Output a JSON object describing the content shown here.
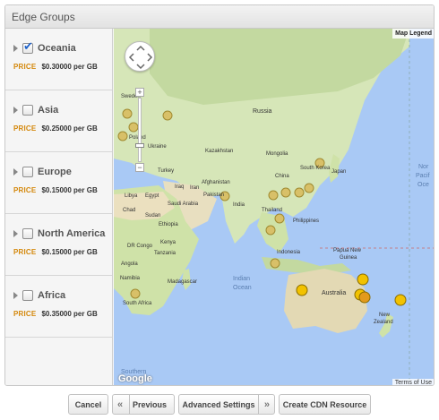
{
  "panel": {
    "title": "Edge Groups"
  },
  "groups": [
    {
      "name": "Oceania",
      "checked": true,
      "price_label": "PRICE",
      "price": "$0.30000 per GB"
    },
    {
      "name": "Asia",
      "checked": false,
      "price_label": "PRICE",
      "price": "$0.25000 per GB"
    },
    {
      "name": "Europe",
      "checked": false,
      "price_label": "PRICE",
      "price": "$0.15000 per GB"
    },
    {
      "name": "North America",
      "checked": false,
      "price_label": "PRICE",
      "price": "$0.15000 per GB"
    },
    {
      "name": "Africa",
      "checked": false,
      "price_label": "PRICE",
      "price": "$0.35000 per GB"
    }
  ],
  "map": {
    "legend_button": "Map Legend",
    "terms_link": "Terms of Use",
    "google_logo": "Google",
    "zoom_in": "+",
    "zoom_out": "−",
    "labels": {
      "russia": "Russia",
      "sweden": "Sweden",
      "poland": "Poland",
      "ukraine": "Ukraine",
      "turkey": "Turkey",
      "kazakhstan": "Kazakhstan",
      "mongolia": "Mongolia",
      "china": "China",
      "south_korea": "South Korea",
      "japan": "Japan",
      "afghanistan": "Afghanistan",
      "iraq": "Iraq",
      "iran": "Iran",
      "libya": "Libya",
      "egypt": "Egypt",
      "saudi_arabia": "Saudi Arabia",
      "pakistan": "Pakistan",
      "india": "India",
      "thailand": "Thailand",
      "philippines": "Philippines",
      "chad": "Chad",
      "sudan": "Sudan",
      "ethiopia": "Ethiopia",
      "kenya": "Kenya",
      "dr_congo": "DR Congo",
      "tanzania": "Tanzania",
      "angola": "Angola",
      "namibia": "Namibia",
      "madagascar": "Madagascar",
      "south_africa": "South Africa",
      "indian_ocean_1": "Indian",
      "indian_ocean_2": "Ocean",
      "indonesia": "Indonesia",
      "papua_new_guinea_1": "Papua New",
      "papua_new_guinea_2": "Guinea",
      "australia": "Australia",
      "new_zealand_1": "New",
      "new_zealand_2": "Zealand",
      "southern_ocean": "Southern",
      "north_pacific_1": "Nor",
      "north_pacific_2": "Pacif",
      "north_pacific_3": "Oce"
    }
  },
  "footer": {
    "cancel": "Cancel",
    "prev_arrow": "«",
    "previous": "Previous",
    "advanced": "Advanced Settings",
    "next_arrow": "»",
    "create": "Create CDN Resource"
  },
  "colors": {
    "price_accent": "#d4880b",
    "check_blue": "#1e62c9",
    "ocean": "#a9c9f5",
    "land": "#cfe0b0",
    "pin_active": "#f2c200",
    "pin_inactive": "#d8c068"
  }
}
